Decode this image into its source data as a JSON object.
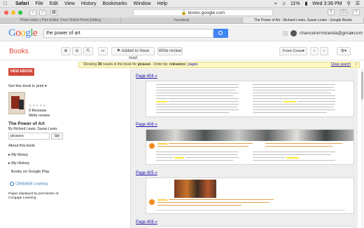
{
  "menubar": {
    "items": [
      "Safari",
      "File",
      "Edit",
      "View",
      "History",
      "Bookmarks",
      "Window",
      "Help"
    ],
    "battery": "11%",
    "datetime": "Wed 3:36 PM"
  },
  "browser": {
    "address": "books.google.com",
    "tabs": [
      "Photo editor | Pixlr Editor: Free Online Photo Editing",
      "Facebook",
      "The Power of Art - Richard Lewis, Susan Lewis - Google Books"
    ]
  },
  "google": {
    "logo": "Google",
    "query": "the power of art",
    "email": "chancelorrmiranda@gmail.com"
  },
  "books_toolbar": {
    "title": "Books",
    "add_label": "Added to Have read",
    "review_label": "Write review",
    "view_select": "Front Cover"
  },
  "sidebar": {
    "view_ebook": "VIEW EBOOK",
    "get_book": "Get this book in print",
    "reviews": "0 Reviews",
    "write_review": "Write review",
    "book_title": "The Power of Art",
    "authors": "By Richard Lewis, Susan Lewis",
    "search_value": "picasso",
    "go": "Go",
    "about": "About this book",
    "my_library": "My library",
    "my_history": "My History",
    "books_play": "Books on Google Play",
    "publisher_logo": "CENGAGE Learning",
    "permission": "Pages displayed by permission of Cengage Learning",
    "permission_link": "Cengage Learning"
  },
  "results": {
    "showing_prefix": "Showing",
    "count": "38",
    "showing_mid": "results in this book for",
    "term": "picasso",
    "order_prefix": "- Order by:",
    "order_by": "relevance",
    "pages_link": "pages",
    "clear_search": "Clear search",
    "close_x": "x",
    "pages": [
      "Page 404 »",
      "Page 406 »",
      "Page 405 »",
      "Page 408 »"
    ]
  },
  "colors": {
    "books_red": "#dd4b39",
    "google_blue": "#4285f4",
    "link_blue": "#1a0dab",
    "highlight_yellow": "#ffeb3b"
  }
}
